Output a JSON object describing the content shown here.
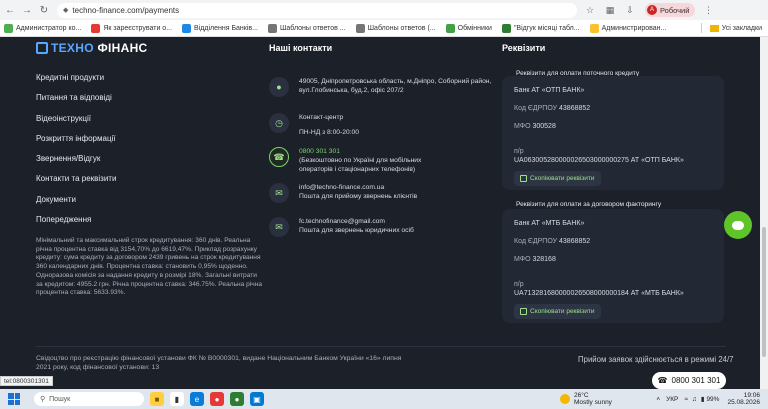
{
  "browser": {
    "url": "techno-finance.com/payments",
    "profile_initial": "А",
    "profile_label": "Робочий",
    "bookmarks": [
      {
        "label": "Администратор ко...",
        "color": "#4caf50"
      },
      {
        "label": "Як зареєструвати о...",
        "color": "#e53935"
      },
      {
        "label": "Відділення Банків...",
        "color": "#1e88e5"
      },
      {
        "label": "Шаблоны ответов ...",
        "color": "#757575"
      },
      {
        "label": "Шаблоны ответов (...",
        "color": "#757575"
      },
      {
        "label": "Обмінники",
        "color": "#43a047"
      },
      {
        "label": "\"Відгук місяці табл...",
        "color": "#2e7d32"
      },
      {
        "label": "Администрирован...",
        "color": "#fbc02d"
      }
    ],
    "all_bookmarks": "Усі закладки"
  },
  "logo": {
    "part1": "ТЕХНО",
    "part2": "ФІНАНС"
  },
  "menu": [
    "Кредитні продукти",
    "Питання та відповіді",
    "Відеоінструкції",
    "Розкриття інформації",
    "Звернення/Відгук",
    "Контакти та реквізити",
    "Документи",
    "Попередження"
  ],
  "disclaimer": "Мінімальний та максимальний строк кредитування: 360 днів. Реальна річна процентна ставка від 3154,70% до 6619,47%. Приклад розрахунку кредиту: сума кредиту за договором 2439 гривень на строк кредитування 360 календарних днів. Процентна ставка: становить 0,95% щоденно. Одноразова комісія за надання кредиту в розмірі 18%. Загальні витрати за кредитом: 4955.2 грн. Річна процентна ставка: 346.75%. Реальна річна процентна ставка: 5633.93%.",
  "contacts": {
    "title": "Наші контакти",
    "address": "49005, Дніпропетровська область, м.Дніпро, Соборний район, вул.Глобинська, буд.2, офіс 207/2",
    "center_title": "Контакт-центр",
    "hours": "ПН-НД з 8:00-20:00",
    "phone": "0800 301 301",
    "phone_note": "(Безкоштовно по Україні для мобільних операторів і стаціонарних телефонів)",
    "email": "info@techno-finance.com.ua",
    "email_note": "Пошта для прийому звернень клієнтів",
    "email2": "fc.technofinance@gmail.com",
    "email2_note": "Пошта для звернень юридичних осіб"
  },
  "requisites": {
    "title": "Реквізити",
    "card1": {
      "label": "Реквізити для оплати поточного кредиту",
      "bank": "Банк АТ «ОТП БАНК»",
      "edrpou_label": "Код ЄДРПОУ",
      "edrpou": "43868852",
      "mfo_label": "МФО",
      "mfo": "300528",
      "pr_label": "п/р",
      "account": "UA063005280000026503000000275 АТ «ОТП БАНК»",
      "copy": "Скопіювати реквізити"
    },
    "card2": {
      "label": "Реквізити для оплати за договором факторингу",
      "bank": "Банк АТ «МТБ БАНК»",
      "edrpou_label": "Код ЄДРПОУ",
      "edrpou": "43868852",
      "mfo_label": "МФО",
      "mfo": "328168",
      "pr_label": "п/р",
      "account": "UA713281680000026508000000184 АТ «МТБ БАНК»",
      "copy": "Скопіювати реквізити"
    }
  },
  "footer": {
    "license": "Свідоцтво про реєстрацію фінансової установи ФК № В0000301, видане Національним Банком України «16» липня 2021 року, код фінансової установи: 13",
    "hours": "Прийом заявок здійснюється в режимі 24/7",
    "phone_button": "0800 301 301"
  },
  "status_tip": "tel:0800301301",
  "taskbar": {
    "search": "Пошук",
    "temp": "26°C",
    "weather": "Mostly sunny",
    "lang": "УКР",
    "battery": "99%",
    "time": "19:06",
    "date": "25.08.2026"
  }
}
